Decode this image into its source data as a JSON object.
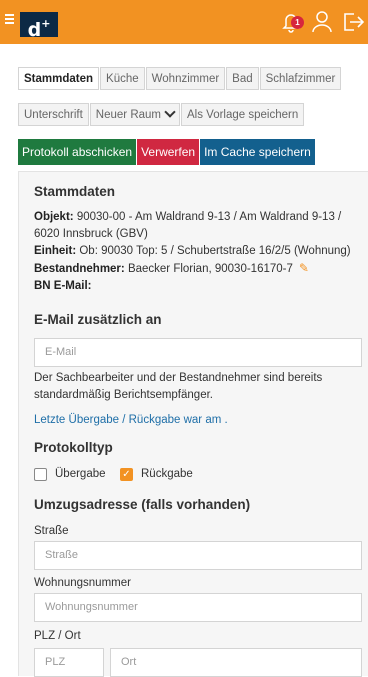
{
  "tabs": [
    {
      "label": "Stammdaten",
      "active": true
    },
    {
      "label": "Küche"
    },
    {
      "label": "Wohnzimmer"
    },
    {
      "label": "Bad"
    },
    {
      "label": "Schlafzimmer"
    }
  ],
  "row2": {
    "unterschrift": "Unterschrift",
    "neuer_raum": "Neuer Raum",
    "vorlage": "Als Vorlage speichern"
  },
  "actions": {
    "abschicken": "Protokoll abschicken",
    "verwerfen": "Verwerfen",
    "cache": "Im Cache speichern"
  },
  "notification_count": "1",
  "stammdaten": {
    "title": "Stammdaten",
    "objekt_label": "Objekt:",
    "objekt_value": " 90030-00 - Am Waldrand 9-13 / Am Waldrand 9-13 / 6020 Innsbruck (GBV)",
    "einheit_label": "Einheit:",
    "einheit_value": " Ob: 90030 Top: 5 / Schubertstraße 16/2/5 (Wohnung)",
    "bn_label": "Bestandnehmer:",
    "bn_value": " Baecker Florian, 90030-16170-7",
    "bn_email_label": "BN E-Mail:"
  },
  "email": {
    "title": "E-Mail zusätzlich an",
    "placeholder": "E-Mail",
    "hint": "Der Sachbearbeiter und der Bestandnehmer sind bereits standardmäßig Berichtsempfänger.",
    "link": "Letzte Übergabe / Rückgabe war am ."
  },
  "protokolltyp": {
    "title": "Protokolltyp",
    "uebergabe": "Übergabe",
    "rueckgabe": "Rückgabe",
    "selected": "Rückgabe"
  },
  "umzug": {
    "title": "Umzugsadresse (falls vorhanden)",
    "strasse_label": "Straße",
    "strasse_placeholder": "Straße",
    "wnr_label": "Wohnungsnummer",
    "wnr_placeholder": "Wohnungsnummer",
    "plzort_label": "PLZ / Ort",
    "plz_placeholder": "PLZ",
    "ort_placeholder": "Ort"
  },
  "colors": {
    "header": "#f29222",
    "logo_bg": "#0c2945",
    "green": "#1f7a3f",
    "red": "#d02841",
    "blue": "#13608e",
    "link": "#1f6fa8"
  },
  "icons": [
    "menu-icon",
    "logo",
    "bell-icon",
    "user-icon",
    "logout-icon",
    "edit-icon",
    "chevron-down-icon"
  ]
}
